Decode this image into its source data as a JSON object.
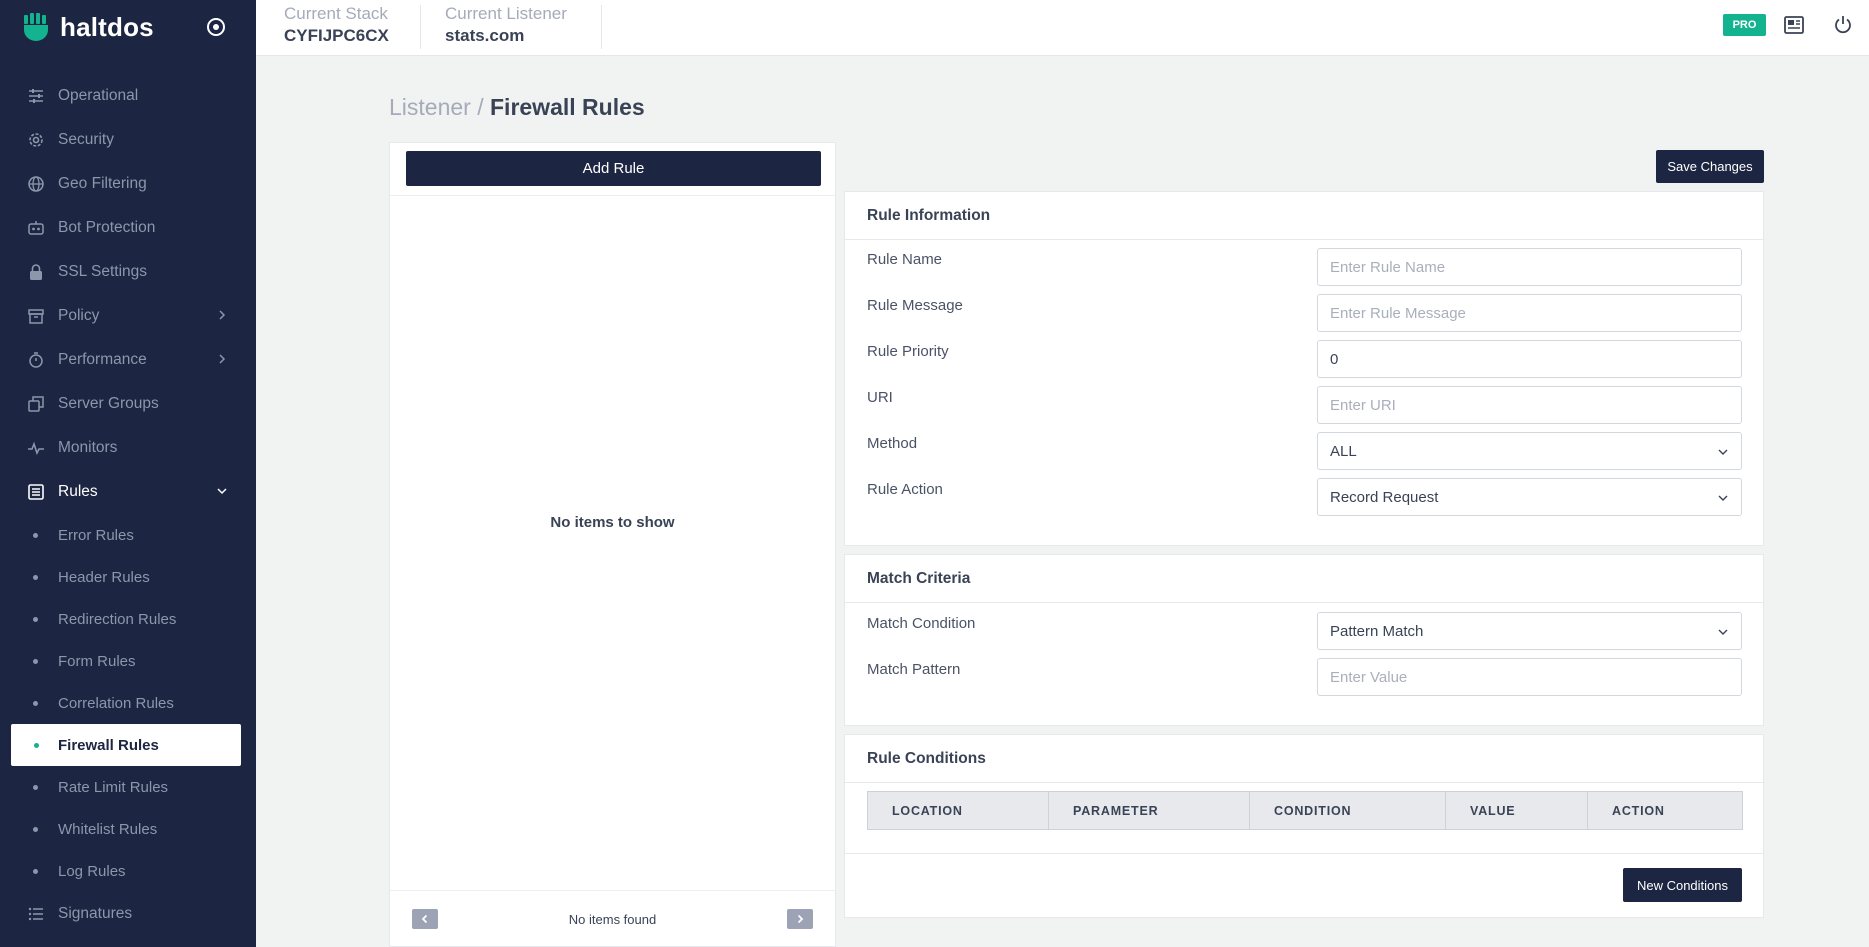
{
  "brand": {
    "name": "haltdos"
  },
  "sidebar": {
    "items": [
      {
        "label": "Operational",
        "icon": "sliders-icon"
      },
      {
        "label": "Security",
        "icon": "gear-icon"
      },
      {
        "label": "Geo Filtering",
        "icon": "globe-icon"
      },
      {
        "label": "Bot Protection",
        "icon": "bot-icon"
      },
      {
        "label": "SSL Settings",
        "icon": "lock-icon"
      },
      {
        "label": "Policy",
        "icon": "archive-icon",
        "has_children": true
      },
      {
        "label": "Performance",
        "icon": "stopwatch-icon",
        "has_children": true
      },
      {
        "label": "Server Groups",
        "icon": "copy-icon"
      },
      {
        "label": "Monitors",
        "icon": "pulse-icon"
      },
      {
        "label": "Rules",
        "icon": "list-icon",
        "expanded": true
      }
    ],
    "rules_sub": [
      {
        "label": "Error Rules"
      },
      {
        "label": "Header Rules"
      },
      {
        "label": "Redirection Rules"
      },
      {
        "label": "Form Rules"
      },
      {
        "label": "Correlation Rules"
      },
      {
        "label": "Firewall Rules",
        "active": true
      },
      {
        "label": "Rate Limit Rules"
      },
      {
        "label": "Whitelist Rules"
      },
      {
        "label": "Log Rules"
      }
    ],
    "after": [
      {
        "label": "Signatures",
        "icon": "bullet-list-icon"
      }
    ]
  },
  "topbar": {
    "stack_label": "Current Stack",
    "stack_value": "CYFIJPC6CX",
    "listener_label": "Current Listener",
    "listener_value": "stats.com",
    "badge": "PRO"
  },
  "breadcrumb": {
    "parent": "Listener /",
    "current": "Firewall Rules"
  },
  "list": {
    "add_label": "Add Rule",
    "empty": "No items to show",
    "footer": "No items found"
  },
  "save_label": "Save Changes",
  "rule_info": {
    "title": "Rule Information",
    "fields": [
      {
        "label": "Rule Name",
        "placeholder": "Enter Rule Name",
        "value": ""
      },
      {
        "label": "Rule Message",
        "placeholder": "Enter Rule Message",
        "value": ""
      },
      {
        "label": "Rule Priority",
        "placeholder": "",
        "value": "0"
      },
      {
        "label": "URI",
        "placeholder": "Enter URI",
        "value": ""
      },
      {
        "label": "Method",
        "value": "ALL",
        "select": true
      },
      {
        "label": "Rule Action",
        "value": "Record Request",
        "select": true
      }
    ]
  },
  "match": {
    "title": "Match Criteria",
    "condition_label": "Match Condition",
    "condition_value": "Pattern Match",
    "pattern_label": "Match Pattern",
    "pattern_placeholder": "Enter Value"
  },
  "conditions": {
    "title": "Rule Conditions",
    "columns": [
      "LOCATION",
      "PARAMETER",
      "CONDITION",
      "VALUE",
      "ACTION"
    ],
    "new_label": "New Conditions"
  },
  "colors": {
    "sidebar_bg": "#1c2541",
    "accent": "#13b38f",
    "page_bg": "#f1f3f2"
  }
}
